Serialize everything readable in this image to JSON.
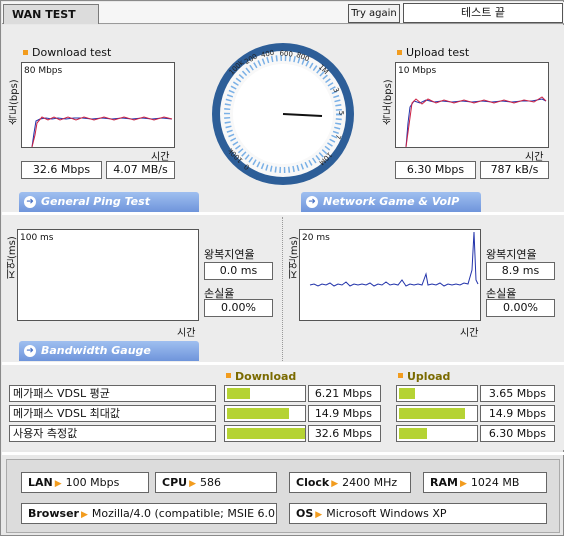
{
  "topbar": {
    "tab_label": "WAN TEST",
    "try_again": "Try again",
    "status": "테스트 끝"
  },
  "download": {
    "title": "Download test",
    "axis_label": "속도(bps)",
    "scale": "80 Mbps",
    "time_label": "시간",
    "speed": "32.6 Mbps",
    "rate": "4.07 MB/s"
  },
  "upload": {
    "title": "Upload test",
    "axis_label": "속도(bps)",
    "scale": "10 Mbps",
    "time_label": "시간",
    "speed": "6.30 Mbps",
    "rate": "787 kB/s"
  },
  "gauge": {
    "labels": [
      "100k",
      "200",
      "400",
      "600",
      "800",
      "1M",
      "3",
      "5",
      "7",
      "10M",
      "100k",
      "0"
    ]
  },
  "ping": {
    "button": "General Ping Test",
    "axis_label": "지연(ms)",
    "scale": "100 ms",
    "time_label": "시간",
    "latency_label": "왕복지연율",
    "latency": "0.0 ms",
    "loss_label": "손실율",
    "loss": "0.00%"
  },
  "game": {
    "button": "Network Game & VoIP Test",
    "axis_label": "지연(ms)",
    "scale": "20 ms",
    "time_label": "시간",
    "latency_label": "왕복지연율",
    "latency": "8.9 ms",
    "loss_label": "손실율",
    "loss": "0.00%"
  },
  "bandwidth": {
    "button": "Bandwidth Gauge",
    "download_head": "Download",
    "upload_head": "Upload",
    "rows": [
      {
        "label": "메가패스 VDSL 평균",
        "down": "6.21 Mbps",
        "down_fill": 0.29,
        "up": "3.65 Mbps",
        "up_fill": 0.2
      },
      {
        "label": "메가패스 VDSL 최대값",
        "down": "14.9 Mbps",
        "down_fill": 0.8,
        "up": "14.9 Mbps",
        "up_fill": 0.85
      },
      {
        "label": "사용자 측정값",
        "down": "32.6 Mbps",
        "down_fill": 1.0,
        "up": "6.30 Mbps",
        "up_fill": 0.36
      }
    ]
  },
  "system": {
    "lan_key": "LAN",
    "lan_val": "100 Mbps",
    "cpu_key": "CPU",
    "cpu_val": "586",
    "clock_key": "Clock",
    "clock_val": "2400 MHz",
    "ram_key": "RAM",
    "ram_val": "1024 MB",
    "browser_key": "Browser",
    "browser_val": "Mozilla/4.0 (compatible; MSIE 6.0",
    "os_key": "OS",
    "os_val": "Microsoft Windows XP"
  },
  "colors": {
    "accent": "#f29c1e",
    "bar": "#b5d334",
    "button_blue": "#6f95db",
    "gauge_ring": "#2d5e98"
  }
}
